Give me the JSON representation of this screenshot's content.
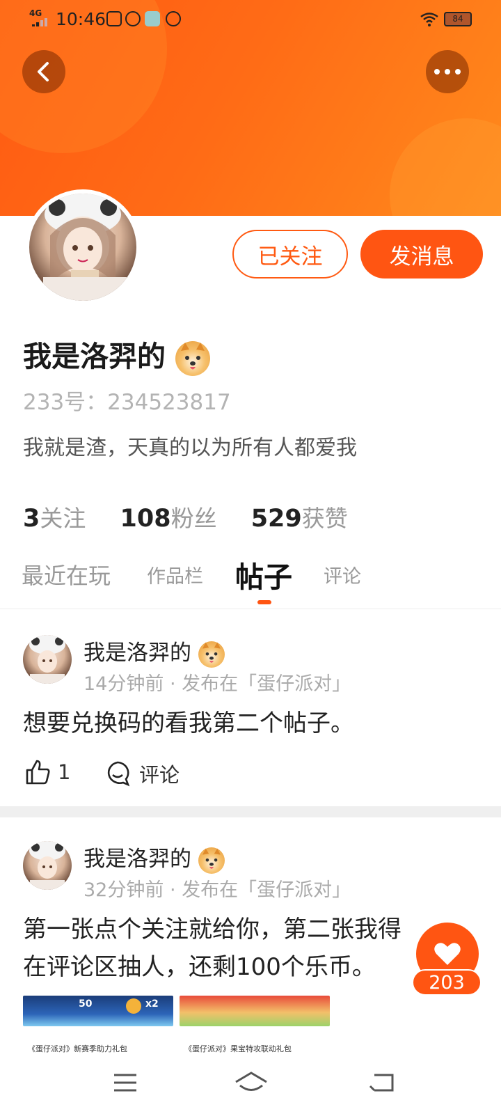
{
  "status_bar": {
    "network": "4G",
    "time": "10:46",
    "battery": "84"
  },
  "header": {
    "back_icon": "chevron-left-icon",
    "more_icon": "more-horizontal-icon"
  },
  "profile": {
    "follow_button": "已关注",
    "message_button": "发消息",
    "name": "我是洛羿的",
    "uid": "233号：234523817",
    "bio": "我就是渣，天真的以为所有人都爱我",
    "stats": [
      {
        "num": "3",
        "label": "关注"
      },
      {
        "num": "108",
        "label": "粉丝"
      },
      {
        "num": "529",
        "label": "获赞"
      }
    ]
  },
  "tabs": [
    {
      "label": "最近在玩",
      "active": false
    },
    {
      "label": "作品栏",
      "active": false
    },
    {
      "label": "帖子",
      "active": true
    },
    {
      "label": "评论",
      "active": false
    }
  ],
  "posts": [
    {
      "author": "我是洛羿的",
      "meta": "14分钟前 · 发布在「蛋仔派对」",
      "content": "想要兑换码的看我第二个帖子。",
      "likes": "1",
      "comment_label": "评论"
    },
    {
      "author": "我是洛羿的",
      "meta": "32分钟前 · 发布在「蛋仔派对」",
      "content": "第一张点个关注就给你，第二张我得\n在评论区抽人，还剩100个乐币。",
      "images": [
        {
          "badge1": "50",
          "badge2": "x2",
          "caption": "《蛋仔派对》新赛季助力礼包"
        },
        {
          "caption": "《蛋仔派对》果宝特攻联动礼包"
        }
      ]
    }
  ],
  "floating": {
    "like_count": "203",
    "icon": "heart-icon"
  },
  "navbar": {
    "icons": [
      "menu-icon",
      "home-icon",
      "back-icon"
    ]
  },
  "colors": {
    "accent": "#ff5512",
    "banner_start": "#ff5a12",
    "banner_end": "#ff8a1c"
  }
}
